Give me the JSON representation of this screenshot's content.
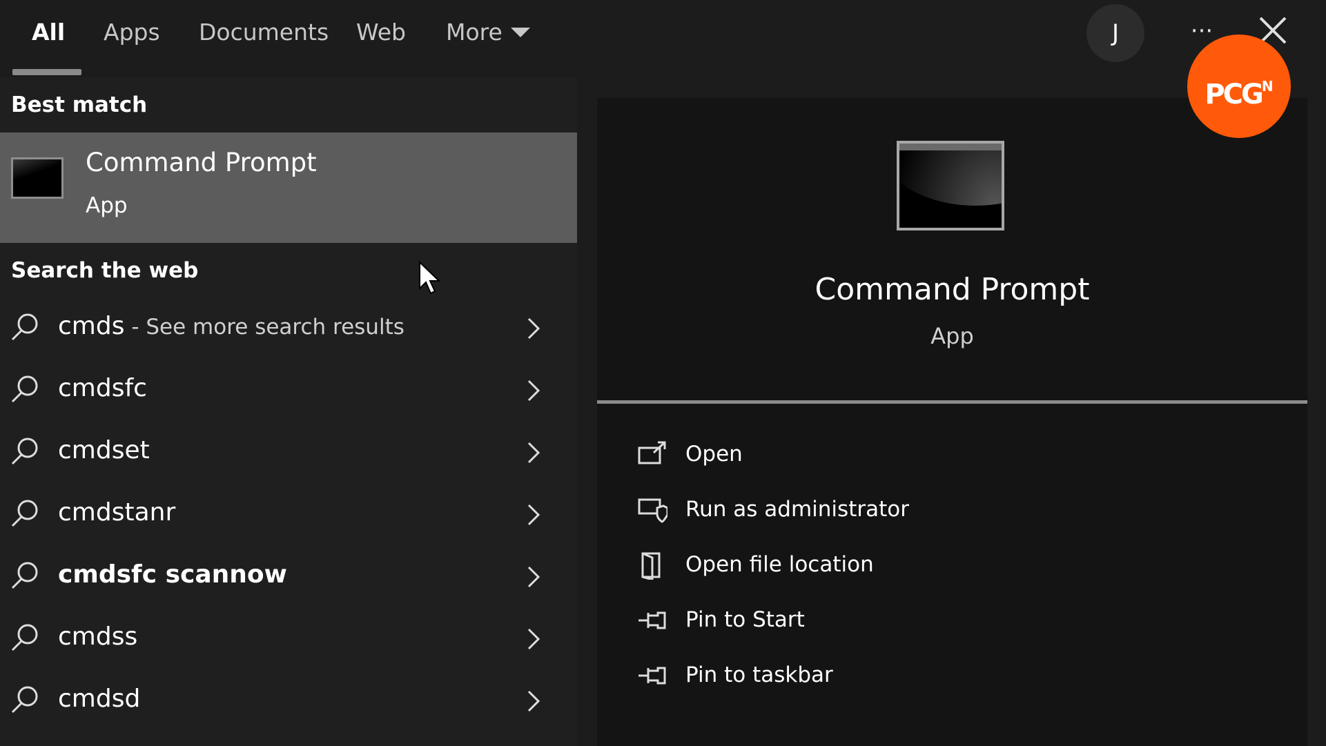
{
  "tabs": [
    {
      "label": "All",
      "active": true
    },
    {
      "label": "Apps"
    },
    {
      "label": "Documents"
    },
    {
      "label": "Web"
    },
    {
      "label": "More"
    }
  ],
  "header": {
    "avatar_initial": "J",
    "more_options_icon": "ellipsis-icon",
    "close_icon": "close-icon"
  },
  "best_match": {
    "heading": "Best match",
    "title": "Command Prompt",
    "subtitle": "App",
    "icon": "command-prompt-icon"
  },
  "web": {
    "heading": "Search the web",
    "items": [
      {
        "query": "cmds",
        "suffix": " - See more search results"
      },
      {
        "query": "cmdsfc"
      },
      {
        "query": "cmdset"
      },
      {
        "query": "cmdstanr"
      },
      {
        "query": "cmdsfc scannow"
      },
      {
        "query": "cmdss"
      },
      {
        "query": "cmdsd"
      }
    ]
  },
  "details": {
    "title": "Command Prompt",
    "subtitle": "App",
    "actions": [
      {
        "label": "Open",
        "icon": "open-icon"
      },
      {
        "label": "Run as administrator",
        "icon": "shield-icon"
      },
      {
        "label": "Open file location",
        "icon": "file-location-icon"
      },
      {
        "label": "Pin to Start",
        "icon": "pin-icon"
      },
      {
        "label": "Pin to taskbar",
        "icon": "pin-icon"
      }
    ]
  },
  "watermark": {
    "text": "PCG",
    "superscript": "N",
    "color": "#ff5a0a"
  },
  "colors": {
    "background": "#1c1c1c",
    "selected_row": "#5c5c5c",
    "detail_panel": "#141414"
  }
}
